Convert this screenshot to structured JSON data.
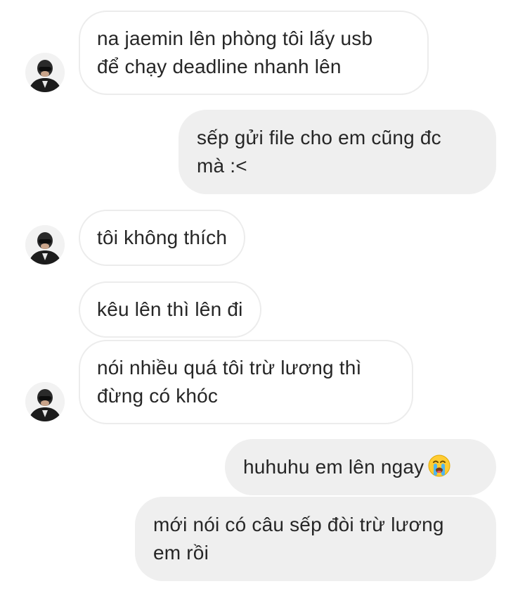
{
  "messages": [
    {
      "side": "incoming",
      "text": "na jaemin lên phòng tôi lấy usb\nđể chạy deadline nhanh lên"
    },
    {
      "side": "outgoing",
      "text": "sếp gửi file cho em cũng đc\nmà :<"
    },
    {
      "side": "incoming",
      "text": "tôi không thích"
    },
    {
      "side": "incoming",
      "text": "kêu lên thì lên đi"
    },
    {
      "side": "incoming",
      "text": "nói nhiều quá tôi trừ lương thì\nđừng có khóc"
    },
    {
      "side": "outgoing",
      "text": "huhuhu em lên ngay",
      "emoji": "loudly-crying-face-icon"
    },
    {
      "side": "outgoing",
      "text": "mới nói có câu sếp đòi trừ lương\nem rồi"
    }
  ],
  "colors": {
    "incoming_bg": "#ffffff",
    "incoming_border": "#ececec",
    "outgoing_bg": "#efefef",
    "text": "#262626"
  }
}
